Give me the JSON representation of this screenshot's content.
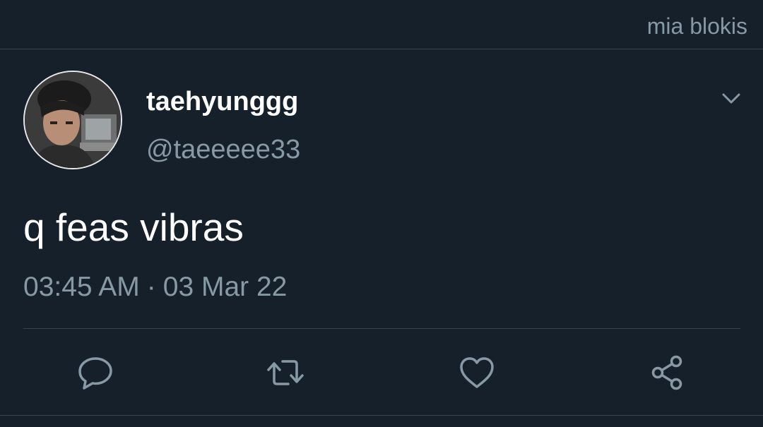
{
  "topbar": {
    "label": "mia blokis"
  },
  "tweet": {
    "display_name": "taehyunggg",
    "handle": "@taeeeee33",
    "text": "q feas vibras",
    "time": "03:45 AM",
    "separator": "·",
    "date": "03 Mar 22"
  },
  "actions": [
    {
      "name": "reply",
      "icon": "reply-icon"
    },
    {
      "name": "retweet",
      "icon": "retweet-icon"
    },
    {
      "name": "like",
      "icon": "heart-icon"
    },
    {
      "name": "share",
      "icon": "share-icon"
    }
  ],
  "colors": {
    "background": "#15202b",
    "secondary_text": "#8899a6",
    "divider": "#38444d",
    "primary_text": "#ffffff"
  }
}
